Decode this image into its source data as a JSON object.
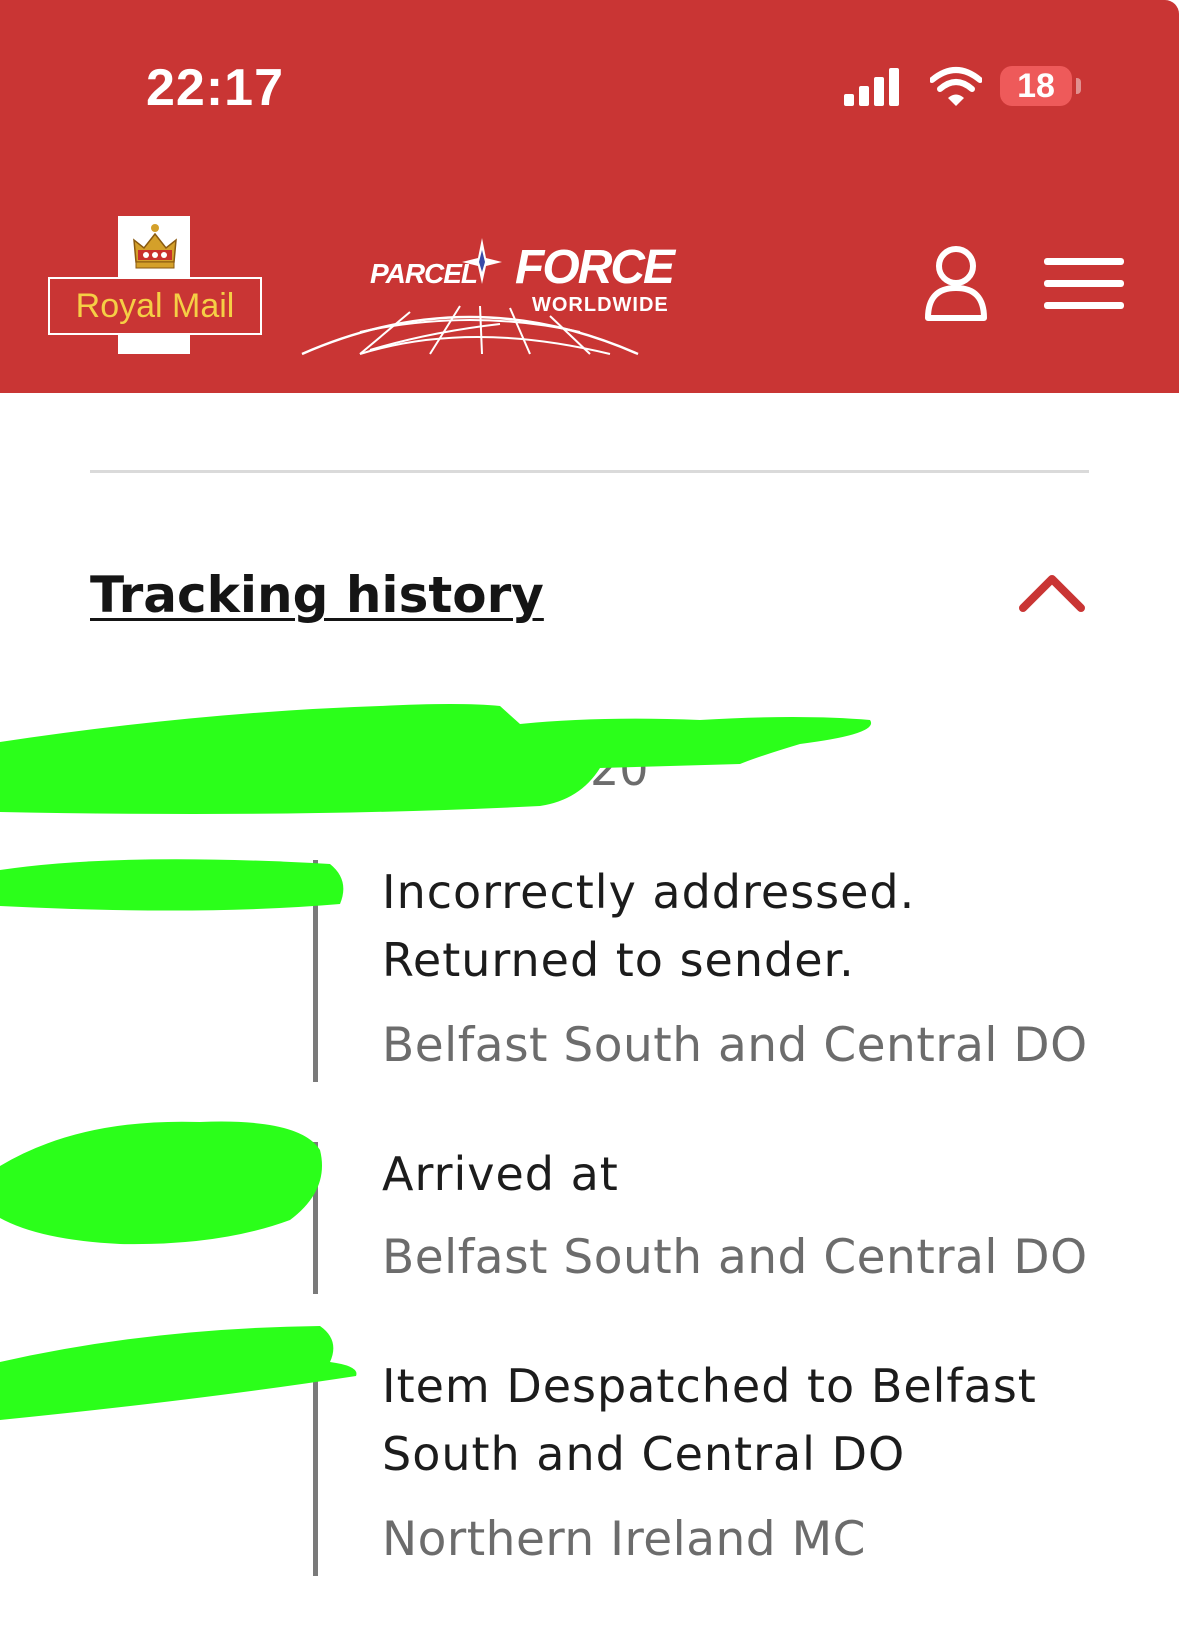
{
  "status_bar": {
    "time": "22:17",
    "battery": "18",
    "icons": [
      "signal-icon",
      "wifi-icon",
      "battery-icon"
    ]
  },
  "header": {
    "royal_mail_logo": "Royal Mail",
    "parcelforce_logo": {
      "parcel": "PARCEL",
      "force": "FORCE",
      "worldwide": "WORLDWIDE"
    },
    "icons": [
      "user-icon",
      "menu-icon"
    ],
    "background_color": "#c93534"
  },
  "tracking": {
    "title": "Tracking history",
    "toggle_icon": "chevron-up-icon",
    "date_visible": "20",
    "events": [
      {
        "title_line1": "Incorrectly addressed.",
        "title_line2": "Returned to sender.",
        "location": "Belfast South and Central DO"
      },
      {
        "title_line1": "Arrived at",
        "location": "Belfast South and Central DO"
      },
      {
        "title_line1": "Item Despatched to Belfast",
        "title_line2": "South and Central DO",
        "location": "Northern Ireland MC"
      }
    ]
  }
}
